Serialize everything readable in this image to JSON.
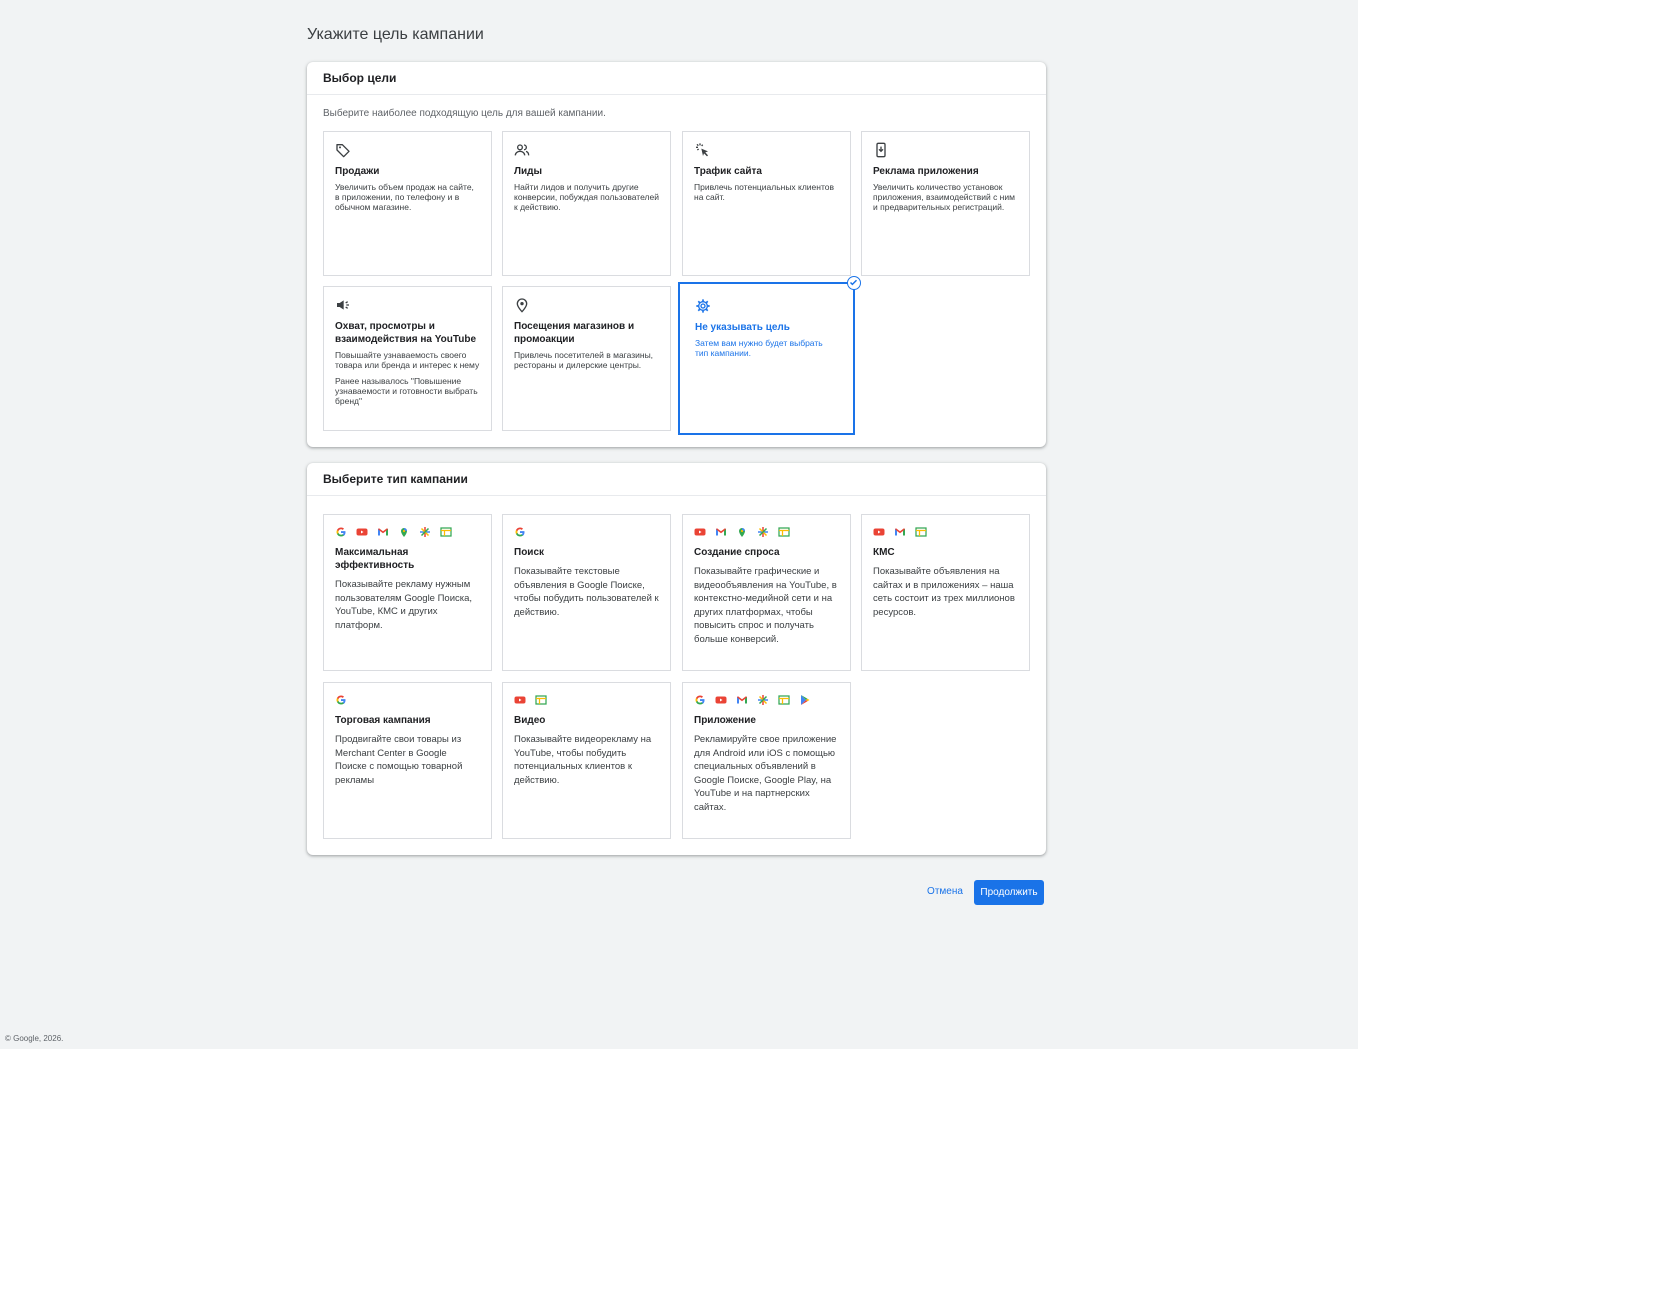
{
  "page": {
    "title": "Укажите цель кампании"
  },
  "goal_panel": {
    "header": "Выбор цели",
    "subtitle": "Выберите наиболее подходящую цель для вашей кампании.",
    "cards": [
      {
        "icon": "tag-icon",
        "title": "Продажи",
        "desc": "Увеличить объем продаж на сайте, в приложении, по телефону и в обычном магазине."
      },
      {
        "icon": "people-icon",
        "title": "Лиды",
        "desc": "Найти лидов и получить другие конверсии, побуждая пользователей к действию."
      },
      {
        "icon": "cursor-click-icon",
        "title": "Трафик сайта",
        "desc": "Привлечь потенциальных клиентов на сайт."
      },
      {
        "icon": "phone-download-icon",
        "title": "Реклама приложения",
        "desc": "Увеличить количество установок приложения, взаимодействий с ним и предварительных регистраций."
      },
      {
        "icon": "megaphone-icon",
        "title": "Охват, просмотры и взаимодействия на YouTube",
        "desc": "Повышайте узнаваемость своего товара или бренда и интерес к нему",
        "note": "Ранее называлось \"Повышение узнаваемости и готовности выбрать бренд\""
      },
      {
        "icon": "map-pin-icon",
        "title": "Посещения магазинов и промоакции",
        "desc": "Привлечь посетителей в магазины, рестораны и дилерские центры."
      },
      {
        "icon": "gear-icon",
        "title": "Не указывать цель",
        "desc": "Затем вам нужно будет выбрать тип кампании.",
        "selected": true
      }
    ]
  },
  "type_panel": {
    "header": "Выберите тип кампании",
    "cards": [
      {
        "icons": [
          "google-icon",
          "youtube-icon",
          "gmail-icon",
          "maps-icon",
          "discover-icon",
          "display-icon"
        ],
        "title": "Максимальная эффективность",
        "desc": "Показывайте рекламу нужным пользователям Google Поиска, YouTube, КМС и других платформ."
      },
      {
        "icons": [
          "google-icon"
        ],
        "title": "Поиск",
        "desc": "Показывайте текстовые объявления в Google Поиске, чтобы побудить пользователей к действию."
      },
      {
        "icons": [
          "youtube-icon",
          "gmail-icon",
          "maps-icon",
          "discover-icon",
          "display-icon"
        ],
        "title": "Создание спроса",
        "desc": "Показывайте графические и видеообъявления на YouTube, в контекстно-медийной сети и на других платформах, чтобы повысить спрос и получать больше конверсий."
      },
      {
        "icons": [
          "youtube-icon",
          "gmail-icon",
          "display-icon"
        ],
        "title": "КМС",
        "desc": "Показывайте объявления на сайтах и в приложениях – наша сеть состоит из трех миллионов ресурсов."
      },
      {
        "icons": [
          "google-icon"
        ],
        "title": "Торговая кампания",
        "desc": "Продвигайте свои товары из Merchant Center в Google Поиске с помощью товарной рекламы"
      },
      {
        "icons": [
          "youtube-icon",
          "display-icon"
        ],
        "title": "Видео",
        "desc": "Показывайте видеорекламу на YouTube, чтобы побудить потенциальных клиентов к действию."
      },
      {
        "icons": [
          "google-icon",
          "youtube-icon",
          "gmail-icon",
          "discover-icon",
          "display-icon",
          "play-icon"
        ],
        "title": "Приложение",
        "desc": "Рекламируйте свое приложение для Android или iOS с помощью специальных объявлений в Google Поиске, Google Play, на YouTube и на партнерских сайтах."
      }
    ]
  },
  "actions": {
    "cancel": "Отмена",
    "continue": "Продолжить"
  },
  "footer": "© Google, 2026.",
  "colors": {
    "accent": "#1a73e8",
    "background": "#f1f3f4"
  }
}
